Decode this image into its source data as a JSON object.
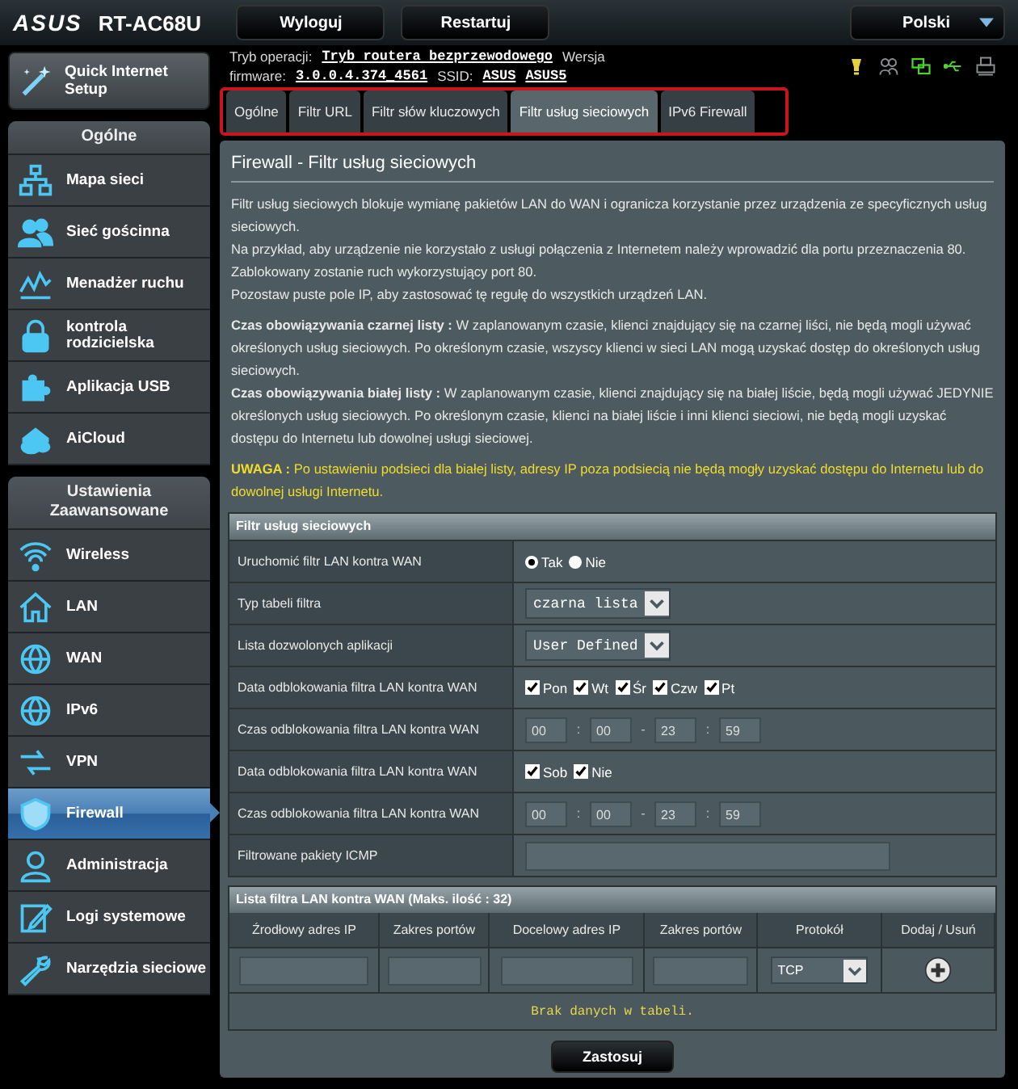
{
  "header": {
    "logo": "ASUS",
    "model": "RT-AC68U",
    "buttons": [
      "Wyloguj",
      "Restartuj"
    ],
    "language": "Polski"
  },
  "info": {
    "lines": [
      [
        {
          "kind": "label",
          "text": "Tryb operacji:"
        },
        {
          "kind": "link",
          "text": "Tryb routera bezprzewodowego"
        },
        {
          "kind": "label",
          "text": "Wersja"
        }
      ],
      [
        {
          "kind": "label",
          "text": "firmware:"
        },
        {
          "kind": "link",
          "text": "3.0.0.4.374_4561"
        },
        {
          "kind": "label",
          "text": "SSID:"
        },
        {
          "kind": "link",
          "text": "ASUS"
        },
        {
          "kind": "link",
          "text": "ASUS5"
        }
      ]
    ]
  },
  "tabs": [
    {
      "label": "Ogólne",
      "selected": false
    },
    {
      "label": "Filtr URL",
      "selected": false
    },
    {
      "label": "Filtr słów kluczowych",
      "selected": false
    },
    {
      "label": "Filtr usług sieciowych",
      "selected": true
    },
    {
      "label": "IPv6 Firewall",
      "selected": false
    }
  ],
  "sidebar": {
    "quick_setup": "Quick Internet Setup",
    "sections": [
      {
        "title": "Ogólne",
        "items": [
          {
            "label": "Mapa sieci",
            "selected": false
          },
          {
            "label": "Sieć gościnna",
            "selected": false
          },
          {
            "label": "Menadżer ruchu",
            "selected": false
          },
          {
            "label": "kontrola rodzicielska",
            "selected": false
          },
          {
            "label": "Aplikacja USB",
            "selected": false
          },
          {
            "label": "AiCloud",
            "selected": false
          }
        ]
      },
      {
        "title": "Ustawienia Zaawansowane",
        "items": [
          {
            "label": "Wireless",
            "selected": false
          },
          {
            "label": "LAN",
            "selected": false
          },
          {
            "label": "WAN",
            "selected": false
          },
          {
            "label": "IPv6",
            "selected": false
          },
          {
            "label": "VPN",
            "selected": false
          },
          {
            "label": "Firewall",
            "selected": true
          },
          {
            "label": "Administracja",
            "selected": false
          },
          {
            "label": "Logi systemowe",
            "selected": false
          },
          {
            "label": "Narzędzia sieciowe",
            "selected": false
          }
        ]
      }
    ]
  },
  "panel": {
    "title": "Firewall - Filtr usług sieciowych",
    "paragraphs": [
      {
        "kind": "plain",
        "lines": [
          "Filtr usług sieciowych blokuje wymianę pakietów LAN do WAN i ogranicza korzystanie przez urządzenia ze specyficznych usług sieciowych.",
          "Na przykład, aby urządzenie nie korzystało z usługi połączenia z Internetem należy wprowadzić dla portu przeznaczenia 80.",
          "Zablokowany zostanie ruch wykorzystujący port 80.",
          "Pozostaw puste pole IP, aby zastosować tę regułę do wszystkich urządzeń LAN."
        ]
      },
      {
        "kind": "plain",
        "lines": [
          "**Czas obowiązywania czarnej listy :** W zaplanowanym czasie, klienci znajdujący się na czarnej liści, nie będą mogli używać określonych usług sieciowych. Po określonym czasie, wszyscy klienci w sieci LAN mogą uzyskać dostęp do określonych usług sieciowych.",
          "**Czas obowiązywania białej listy :** W zaplanowanym czasie, klienci znajdujący się na białej liście, będą mogli używać JEDYNIE określonych usług sieciowych. Po określonym czasie, klienci na białej liście i inni klienci sieciowi, nie będą mogli uzyskać dostępu do Internetu lub dowolnej usługi sieciowej."
        ]
      },
      {
        "kind": "warning",
        "lines": [
          "**UWAGA :** Po ustawieniu podsieci dla białej listy, adresy IP poza podsiecią nie będą mogły uzyskać dostępu do Internetu lub do dowolnej usługi Internetu."
        ]
      }
    ],
    "form": {
      "title": "Filtr usług sieciowych",
      "rows": [
        {
          "kind": "radio",
          "label": "Uruchomić filtr LAN kontra WAN",
          "options": [
            {
              "label": "Tak",
              "selected": true
            },
            {
              "label": "Nie",
              "selected": false
            }
          ]
        },
        {
          "kind": "select",
          "label": "Typ tabeli filtra",
          "value": "czarna lista"
        },
        {
          "kind": "select",
          "label": "Lista dozwolonych aplikacji",
          "value": "User Defined"
        },
        {
          "kind": "checks",
          "label": "Data odblokowania filtra LAN kontra WAN",
          "options": [
            {
              "label": "Pon",
              "checked": true
            },
            {
              "label": "Wt",
              "checked": true
            },
            {
              "label": "Śr",
              "checked": true
            },
            {
              "label": "Czw",
              "checked": true
            },
            {
              "label": "Pt",
              "checked": true
            }
          ]
        },
        {
          "kind": "time",
          "label": "Czas odblokowania filtra LAN kontra WAN",
          "values": [
            "00",
            "00",
            "23",
            "59"
          ],
          "separators": [
            ":",
            "-",
            ":"
          ]
        },
        {
          "kind": "checks",
          "label": "Data odblokowania filtra LAN kontra WAN",
          "options": [
            {
              "label": "Sob",
              "checked": true
            },
            {
              "label": "Nie",
              "checked": true
            }
          ]
        },
        {
          "kind": "time",
          "label": "Czas odblokowania filtra LAN kontra WAN",
          "values": [
            "00",
            "00",
            "23",
            "59"
          ],
          "separators": [
            ":",
            "-",
            ":"
          ]
        },
        {
          "kind": "text",
          "label": "Filtrowane pakiety ICMP"
        }
      ]
    },
    "list": {
      "title": "Lista filtra LAN kontra WAN (Maks. ilość : 32)",
      "columns": [
        "Źrodłowy adres IP",
        "Zakres portów",
        "Docelowy adres IP",
        "Zakres portów",
        "Protokół",
        "Dodaj / Usuń"
      ],
      "protocol": "TCP",
      "empty_message": "Brak danych w tabeli."
    },
    "apply_button": "Zastosuj"
  }
}
